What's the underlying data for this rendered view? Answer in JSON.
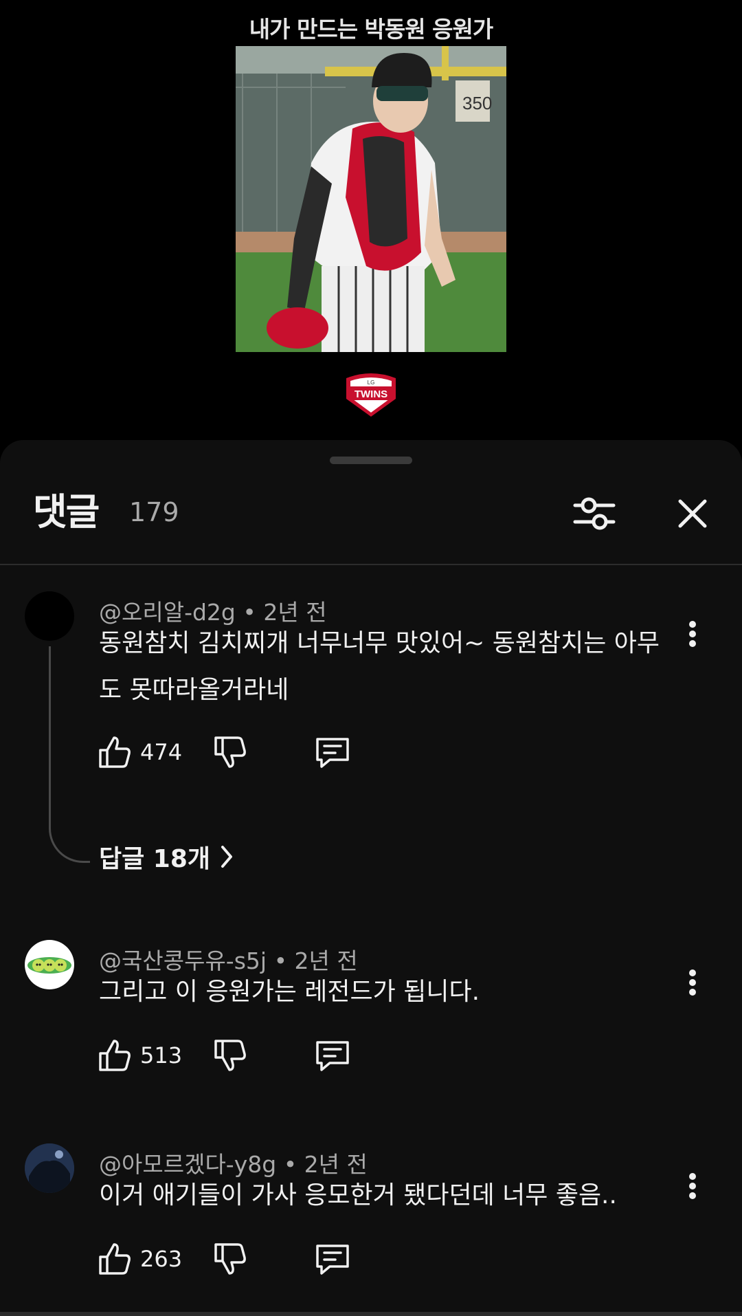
{
  "video": {
    "title": "내가 만드는 박동원 응원가"
  },
  "comments_panel": {
    "title": "댓글",
    "count": "179",
    "filter_icon": "filter-sliders-icon",
    "close_icon": "close-icon"
  },
  "comments": [
    {
      "author": "@오리알-d2g",
      "time": "2년 전",
      "text": "동원참치 김치찌개 너무너무 맛있어~ 동원참치는 아무도 못따라올거라네",
      "likes": "474",
      "replies_label": "답글 18개"
    },
    {
      "author": "@국산콩두유-s5j",
      "time": "2년 전",
      "text": "그리고 이 응원가는 레전드가 됩니다.",
      "likes": "513"
    },
    {
      "author": "@아모르겠다-y8g",
      "time": "2년 전",
      "text": "이거 애기들이 가사 응모한거 됐다던데 너무 좋음..",
      "likes": "263"
    }
  ],
  "colors": {
    "background": "#000000",
    "sheet": "#0f0f0f",
    "text_primary": "#f1f1f1",
    "text_secondary": "#aaaaaa",
    "brand_red": "#c8102e"
  }
}
